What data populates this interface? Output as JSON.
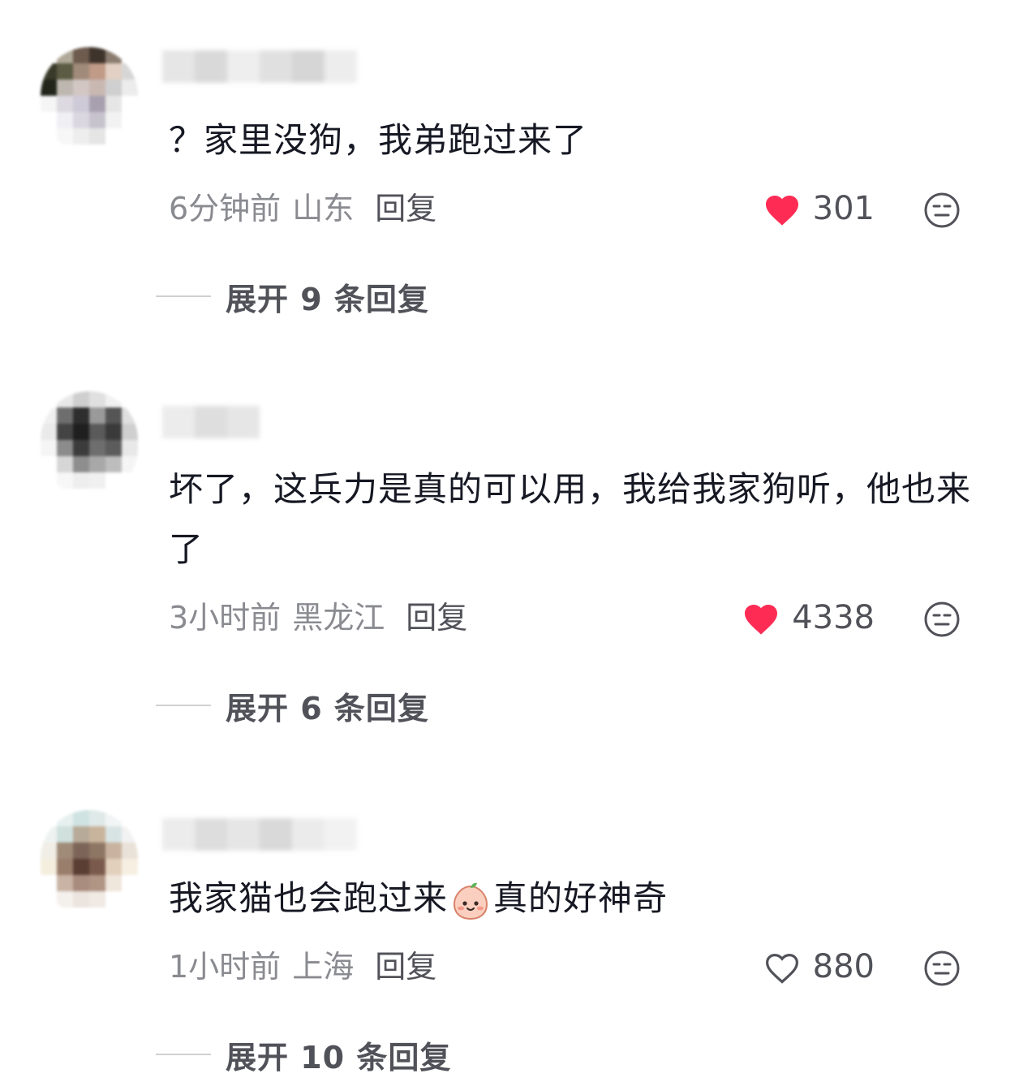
{
  "comments": [
    {
      "text": "？家里没狗，我弟跑过来了",
      "time": "6分钟前",
      "region": "山东",
      "reply_label": "回复",
      "likes": "301",
      "liked": true,
      "expand_label": "展开 9 条回复"
    },
    {
      "text": "坏了，这兵力是真的可以用，我给我家狗听，他也来了",
      "time": "3小时前",
      "region": "黑龙江",
      "reply_label": "回复",
      "likes": "4338",
      "liked": true,
      "expand_label": "展开 6 条回复"
    },
    {
      "text_before_emoji": "我家猫也会跑过来",
      "emoji": "peach-face-emoji",
      "text_after_emoji": "真的好神奇",
      "time": "1小时前",
      "region": "上海",
      "reply_label": "回复",
      "likes": "880",
      "liked": false,
      "expand_label": "展开 10 条回复"
    }
  ],
  "colors": {
    "like_active": "#fe2c55",
    "text_primary": "#161823",
    "text_secondary": "#8a8b91",
    "text_reply": "#515259"
  }
}
